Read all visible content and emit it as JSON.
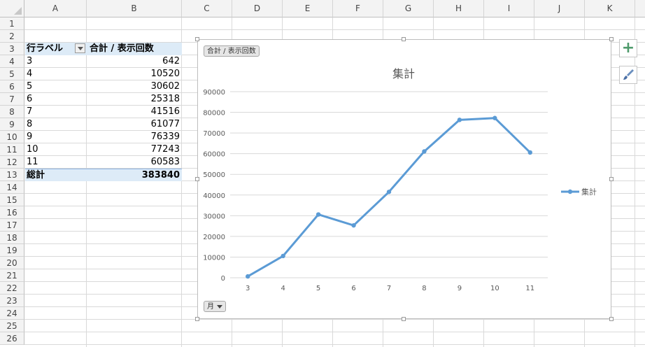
{
  "columns": [
    "A",
    "B",
    "C",
    "D",
    "E",
    "F",
    "G",
    "H",
    "I",
    "J",
    "K"
  ],
  "rows": [
    "1",
    "2",
    "3",
    "4",
    "5",
    "6",
    "7",
    "8",
    "9",
    "10",
    "11",
    "12",
    "13",
    "14",
    "15",
    "16",
    "17",
    "18",
    "19",
    "20",
    "21",
    "22",
    "23",
    "24",
    "25",
    "26"
  ],
  "pivot": {
    "header_label": "行ラベル",
    "header_value": "合計 / 表示回数",
    "items": [
      {
        "label": "3",
        "value": "642"
      },
      {
        "label": "4",
        "value": "10520"
      },
      {
        "label": "5",
        "value": "30602"
      },
      {
        "label": "6",
        "value": "25318"
      },
      {
        "label": "7",
        "value": "41516"
      },
      {
        "label": "8",
        "value": "61077"
      },
      {
        "label": "9",
        "value": "76339"
      },
      {
        "label": "10",
        "value": "77243"
      },
      {
        "label": "11",
        "value": "60583"
      }
    ],
    "total_label": "総計",
    "total_value": "383840"
  },
  "chart_buttons": {
    "value_field": "合計 / 表示回数",
    "axis_field": "月"
  },
  "side_buttons": {
    "add_elements": "+",
    "styles": "brush"
  },
  "colors": {
    "line": "#5b9bd5",
    "pivot_header_fill": "#ddebf7",
    "grid": "#d9d9d9"
  },
  "chart_data": {
    "type": "line",
    "title": "集計",
    "categories": [
      "3",
      "4",
      "5",
      "6",
      "7",
      "8",
      "9",
      "10",
      "11"
    ],
    "series": [
      {
        "name": "集計",
        "values": [
          642,
          10520,
          30602,
          25318,
          41516,
          61077,
          76339,
          77243,
          60583
        ]
      }
    ],
    "ylim": [
      0,
      90000
    ],
    "yticks": [
      "0",
      "10000",
      "20000",
      "30000",
      "40000",
      "50000",
      "60000",
      "70000",
      "80000",
      "90000"
    ],
    "grid": "horizontal",
    "legend_position": "right",
    "xlabel": "",
    "ylabel": ""
  }
}
